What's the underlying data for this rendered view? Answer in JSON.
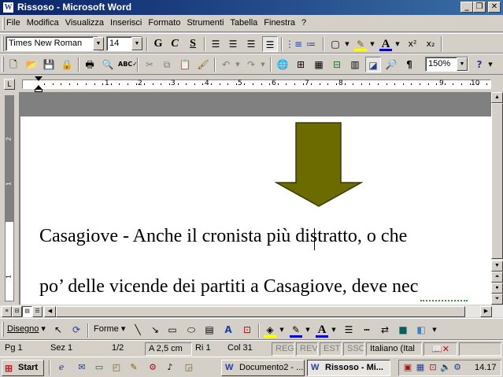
{
  "window": {
    "title": "Rissoso - Microsoft Word",
    "app_icon": "W",
    "minimize": "_",
    "restore": "❐",
    "close": "✕"
  },
  "menu": [
    "File",
    "Modifica",
    "Visualizza",
    "Inserisci",
    "Formato",
    "Strumenti",
    "Tabella",
    "Finestra",
    "?"
  ],
  "formatting": {
    "font": "Times New Roman",
    "size": "14",
    "bold": "G",
    "italic": "C",
    "underline": "S",
    "superscript": "x²",
    "subscript": "x₂"
  },
  "standard": {
    "zoom": "150%",
    "help": "?"
  },
  "ruler": {
    "numbers": [
      "1",
      "2",
      "3",
      "4",
      "5",
      "6",
      "7",
      "8",
      "9",
      "10"
    ]
  },
  "document": {
    "line1": "Casagiove - Anche il cronista più distratto, o che",
    "line2": "po’ delle vicende dei partiti a Casagiove, deve nec"
  },
  "drawing": {
    "draw_label": "Disegno",
    "shapes_label": "Forme"
  },
  "status": {
    "page": "Pg 1",
    "section": "Sez 1",
    "pages": "1/2",
    "at": "A 2,5 cm",
    "line": "Ri 1",
    "col": "Col 31",
    "reg": "REG",
    "rev": "REV",
    "est": "EST",
    "ssc": "SSC",
    "language": "Italiano (Ital"
  },
  "taskbar": {
    "start": "Start",
    "task1": "Documento2 - ...",
    "task2": "Rissoso - Mi...",
    "clock": "14.17"
  },
  "colors": {
    "title_start": "#0a246a",
    "title_end": "#3a6ea5",
    "arrow_fill": "#6b6b00",
    "highlight": "#ffff00",
    "font_color": "#0000cc"
  }
}
